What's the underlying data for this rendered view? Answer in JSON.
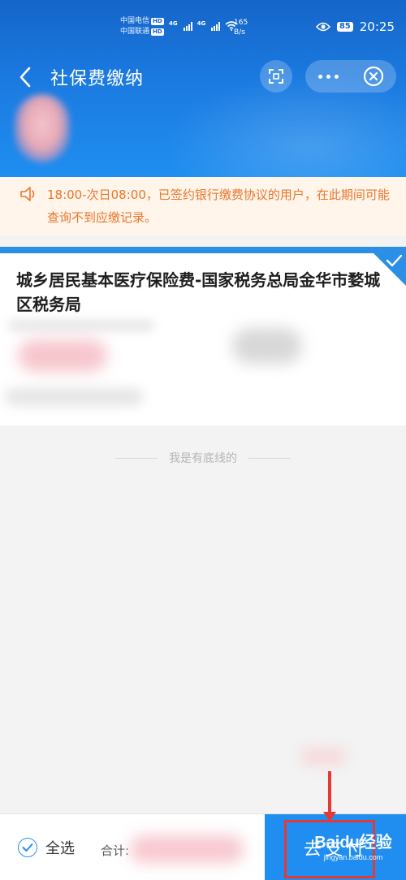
{
  "status_bar": {
    "carrier_1": "中国电信",
    "carrier_2": "中国联通",
    "hd_badge": "HD",
    "network_label": "4G",
    "speed_value": "165",
    "speed_unit": "B/s",
    "battery": "85",
    "time": "20:25"
  },
  "nav": {
    "title": "社保费缴纳",
    "back_icon": "chevron-left-icon",
    "scan_icon": "scan-icon",
    "more_icon": "more-dots-icon",
    "close_icon": "close-circle-icon"
  },
  "notice": {
    "icon": "speaker-icon",
    "text": "18:00-次日08:00，已签约银行缴费协议的用户，在此期间可能查询不到应缴记录。"
  },
  "item": {
    "title": "城乡居民基本医疗保险费-国家税务总局金华市婺城区税务局",
    "selected": true
  },
  "list_end_text": "我是有底线的",
  "footer": {
    "select_all_label": "全选",
    "total_label": "合计:",
    "pay_button_label": "去支付"
  },
  "watermark": {
    "main": "Baidu经验",
    "sub": "jingyan.baidu.com"
  },
  "colors": {
    "primary": "#1f8ef0",
    "notice_text": "#e8762c",
    "notice_bg": "#fff5ea",
    "annotation": "#e53935"
  }
}
